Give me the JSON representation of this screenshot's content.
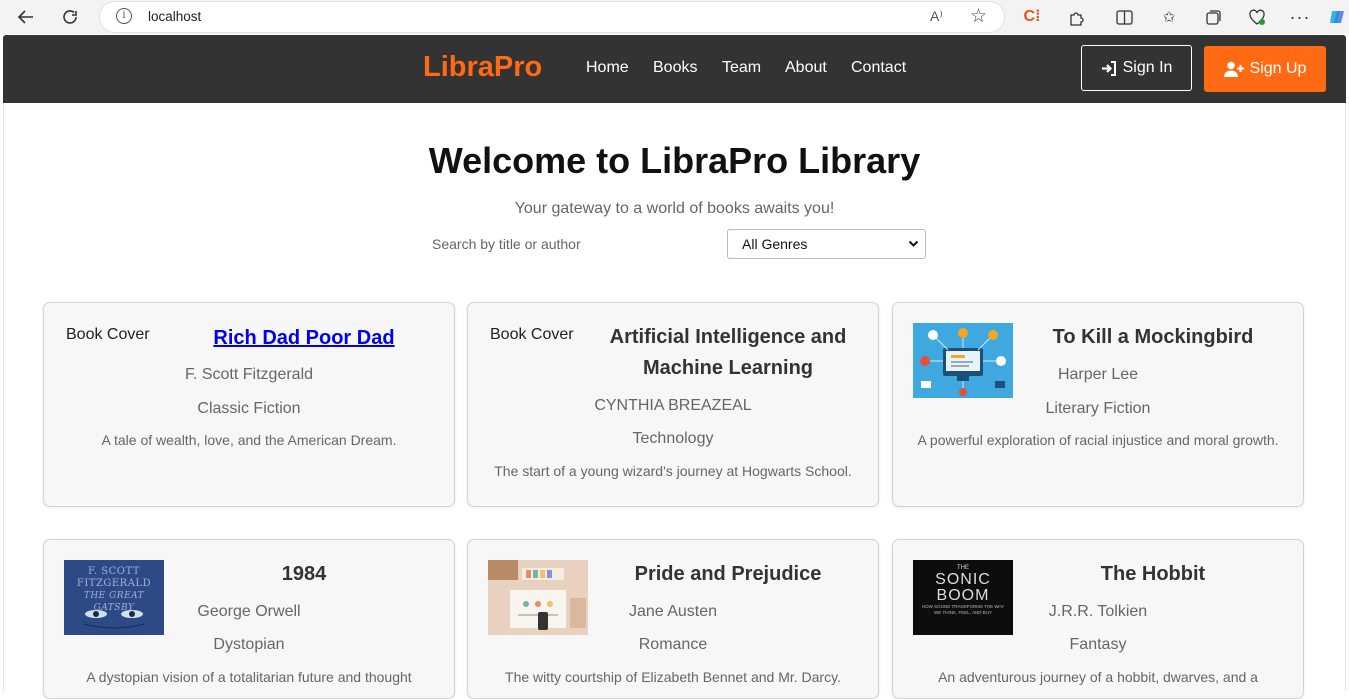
{
  "browser": {
    "url": "localhost",
    "read_aloud": "A⁾"
  },
  "header": {
    "logo": "LibraPro",
    "nav": [
      "Home",
      "Books",
      "Team",
      "About",
      "Contact"
    ],
    "signin": "Sign In",
    "signup": "Sign Up",
    "colors": {
      "bar": "#333333",
      "accent": "#ff6a13"
    }
  },
  "hero": {
    "title": "Welcome to LibraPro Library",
    "subtitle": "Your gateway to a world of books awaits you!",
    "search_placeholder": "Search by title or author",
    "genre_selected": "All Genres"
  },
  "books": [
    {
      "title": "Rich Dad Poor Dad",
      "author": "F. Scott Fitzgerald",
      "genre": "Classic Fiction",
      "desc": "A tale of wealth, love, and the American Dream.",
      "cover_alt": "Book Cover",
      "cover": "broken",
      "title_link": true
    },
    {
      "title": "Artificial Intelligence and Machine Learning",
      "author": "CYNTHIA BREAZEAL",
      "genre": "Technology",
      "desc": "The start of a young wizard's journey at Hogwarts School.",
      "cover_alt": "Book Cover",
      "cover": "broken",
      "title_link": false
    },
    {
      "title": "To Kill a Mockingbird",
      "author": "Harper Lee",
      "genre": "Literary Fiction",
      "desc": "A powerful exploration of racial injustice and moral growth.",
      "cover_alt": "Book Cover",
      "cover": "tech-illustration",
      "title_link": false
    },
    {
      "title": "1984",
      "author": "George Orwell",
      "genre": "Dystopian",
      "desc": "A dystopian vision of a totalitarian future and thought",
      "cover_alt": "Book Cover",
      "cover": "great-gatsby",
      "cover_text": [
        "F. SCOTT",
        "FITZGERALD",
        "THE GREAT GATSBY"
      ],
      "title_link": false
    },
    {
      "title": "Pride and Prejudice",
      "author": "Jane Austen",
      "genre": "Romance",
      "desc": "The witty courtship of Elizabeth Bennet and Mr. Darcy.",
      "cover_alt": "Book Cover",
      "cover": "desk-photo",
      "title_link": false
    },
    {
      "title": "The Hobbit",
      "author": "J.R.R. Tolkien",
      "genre": "Fantasy",
      "desc": "An adventurous journey of a hobbit, dwarves, and a",
      "cover_alt": "Book Cover",
      "cover": "sonic-boom",
      "cover_text": [
        "THE",
        "SONIC",
        "BOOM",
        "HOW SOUND TRANSFORMS THE WAY",
        "WE THINK, FEEL, AND BUY"
      ],
      "title_link": false
    }
  ]
}
